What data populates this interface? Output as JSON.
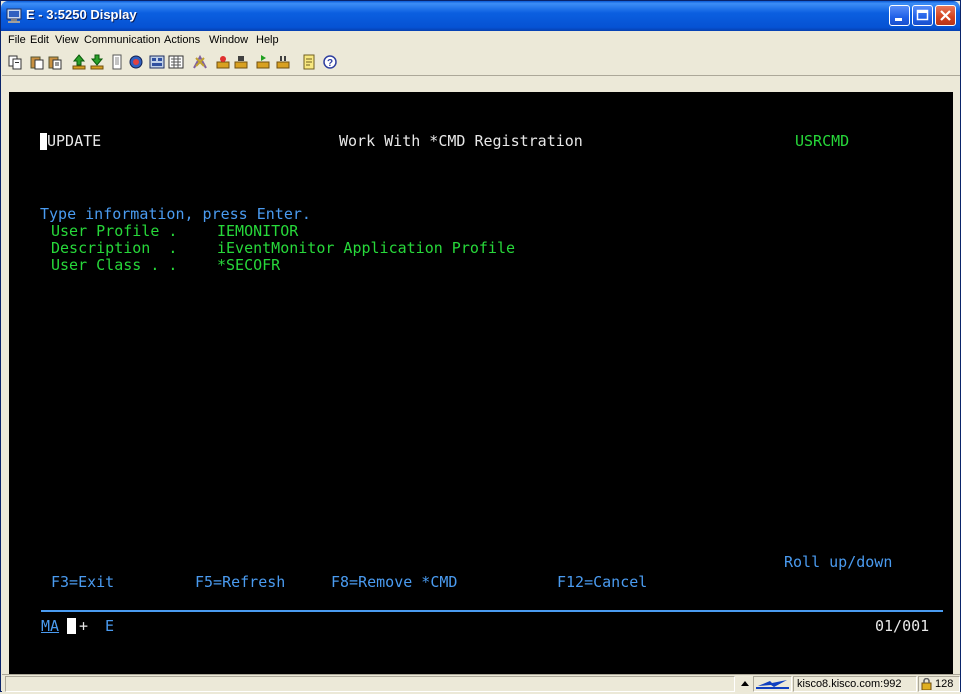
{
  "window": {
    "title": "E - 3:5250 Display"
  },
  "menubar": {
    "items": [
      "File",
      "Edit",
      "View",
      "Communication",
      "Actions",
      "Window",
      "Help"
    ]
  },
  "toolbar": {
    "icons": [
      "copy-icon",
      "paste-icon",
      "paste-next-icon",
      "send-file-icon",
      "receive-file-icon",
      "print-icon",
      "display-icon",
      "keypad-icon",
      "settings-icon",
      "macro-icon",
      "record-macro-icon",
      "stop-macro-icon",
      "play-macro-icon",
      "pause-macro-icon",
      "notes-icon",
      "help-icon"
    ]
  },
  "screen": {
    "program_name": "UPDATE",
    "screen_title": "Work With *CMD Registration",
    "screen_id": "USRCMD",
    "instruction": "Type information, press Enter.",
    "fields": {
      "user_profile_label": "User Profile .",
      "user_profile_value": "IEMONITOR",
      "description_label": "Description  .",
      "description_value": "iEventMonitor Application Profile",
      "user_class_label": "User Class . .",
      "user_class_value": "*SECOFR"
    },
    "roll_hint": "Roll up/down",
    "function_keys": {
      "f3": "F3=Exit",
      "f5": "F5=Refresh",
      "f8": "F8=Remove *CMD",
      "f12": "F12=Cancel"
    },
    "oia": {
      "ma": "MA",
      "plus": "+",
      "e": "E",
      "cursor_pos": "01/001"
    }
  },
  "statusbar": {
    "host": "kisco8.kisco.com:992",
    "session_num": "128"
  }
}
